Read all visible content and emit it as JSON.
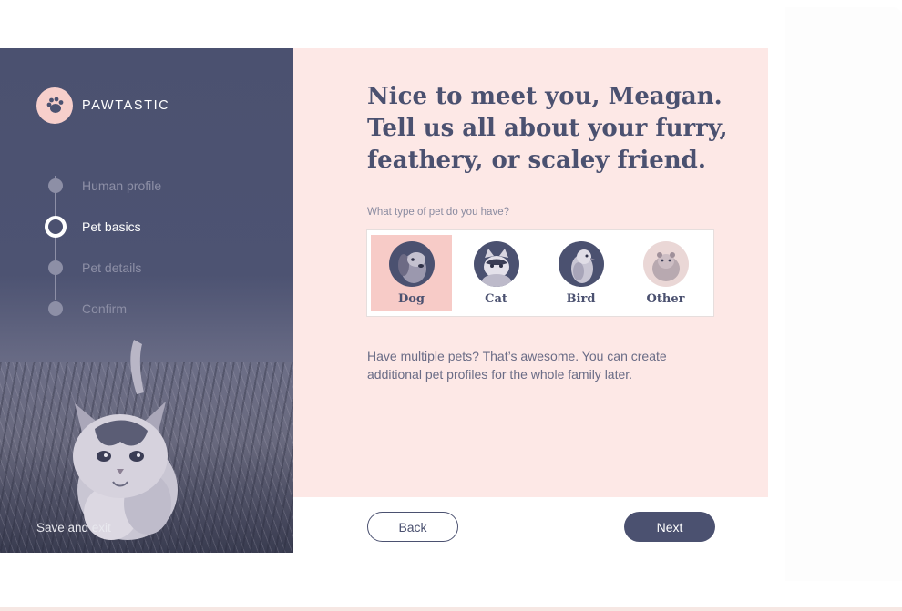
{
  "brand": {
    "name": "PAWTASTIC",
    "logo_icon": "paw-icon",
    "logo_color": "#f7cfcb"
  },
  "steps": [
    {
      "label": "Human profile",
      "state": "complete"
    },
    {
      "label": "Pet basics",
      "state": "active"
    },
    {
      "label": "Pet details",
      "state": "upcoming"
    },
    {
      "label": "Confirm",
      "state": "upcoming"
    }
  ],
  "sidebar": {
    "save_exit_label": "Save and exit",
    "background_color": "#4b5170"
  },
  "main": {
    "headline": "Nice to meet you, Meagan. Tell us all about your furry, feathery, or scaley friend.",
    "question": "What type of pet do you have?",
    "pet_options": [
      {
        "label": "Dog",
        "icon": "dog-photo",
        "selected": true
      },
      {
        "label": "Cat",
        "icon": "cat-photo",
        "selected": false
      },
      {
        "label": "Bird",
        "icon": "bird-photo",
        "selected": false
      },
      {
        "label": "Other",
        "icon": "hamster-photo",
        "selected": false
      }
    ],
    "info": "Have multiple pets? That’s awesome. You can create additional pet profiles for the whole family later.",
    "background_color": "#fde8e6",
    "selected_color": "#f7cbc7"
  },
  "footer": {
    "back_label": "Back",
    "next_label": "Next"
  }
}
